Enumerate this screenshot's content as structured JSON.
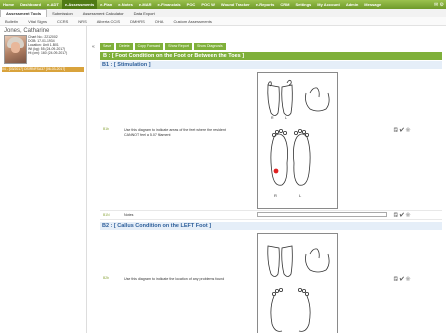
{
  "top_nav": [
    "Home",
    "Dashboard",
    "e-ADT",
    "e-Assessments",
    "e-Plan",
    "e-Notes",
    "e-MAR",
    "e-Financials",
    "POC",
    "POC W",
    "Wound Tracker",
    "e-Reports",
    "CRM",
    "Settings",
    "My Account",
    "Admin",
    "Message"
  ],
  "top_nav_active": 3,
  "tabs": [
    "Assessment Tools",
    "Submission",
    "Assessment Calculator",
    "Data Export"
  ],
  "tabs_active": 0,
  "sub_tabs": [
    "Bulletin",
    "Vital Signs",
    "CCRS",
    "NRS",
    "Alberta CCIS",
    "DMHRS",
    "OHA",
    "Custom Assessments"
  ],
  "patient": {
    "name": "Jones, Catharine",
    "info": [
      "Chart No.: 2212002",
      "DOB: 17-01-1934",
      "Location: Unit 1-B01",
      "Wt (kg): 55 (24-09-2017)",
      "Ht (cm): 160 (24-09-2017)"
    ],
    "selected": "04 - [03/2017]  OSIRNFSA37 [06-03-2017]"
  },
  "toolbar": [
    "Save",
    "Delete",
    "Copy Forward",
    "Show Report",
    "Show Diagnosis"
  ],
  "section_title": "B : [ Foot Condition on the Foot or Between the Toes ]",
  "b1": {
    "title": "B1 : [ Stimulation ]",
    "code": "B1b",
    "question": "Use this diagram to indicate areas of the feet where the resident CANNOT feel a 5.07 filament",
    "notes_code": "B1N",
    "notes_label": "Notes"
  },
  "b2": {
    "title": "B2 : [ Callus Condition on the LEFT Foot ]",
    "code": "B2b",
    "question": "Use this diagram to indicate the location of any problems found"
  },
  "diagram_labels": {
    "R": "R",
    "L": "L"
  },
  "row_icons": "🗒 ✔ ⚙",
  "colors": {
    "accent": "#7fb03a",
    "sub_header_bg": "#e5eef8",
    "mark": "#e02020"
  }
}
